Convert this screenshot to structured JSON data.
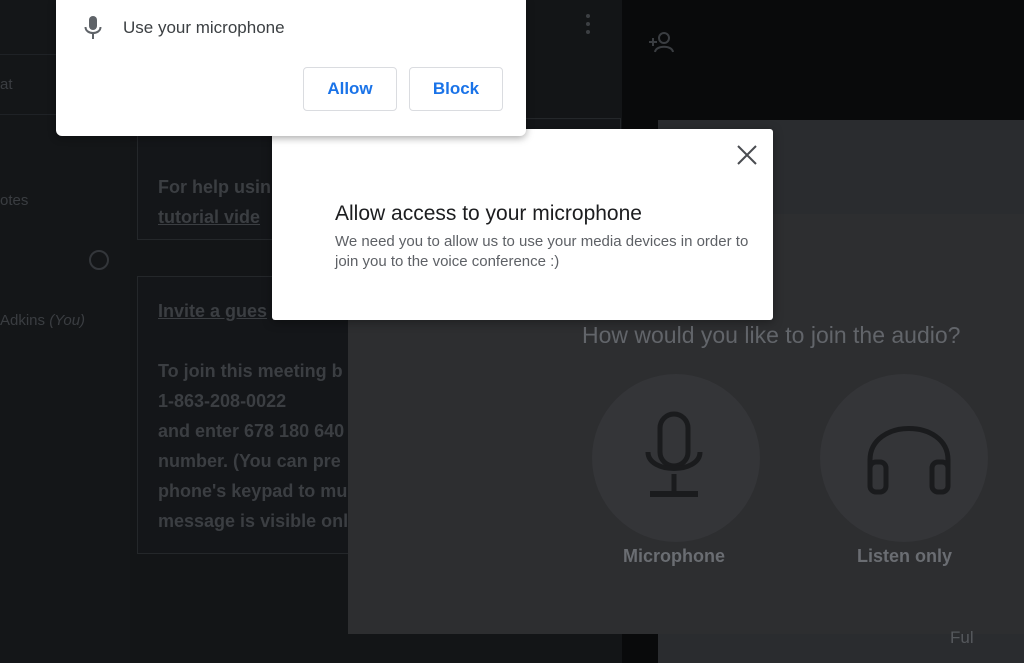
{
  "background": {
    "left_panel": {
      "chat_label": "at",
      "notes_label": "otes",
      "user_name": "Adkins",
      "user_suffix": "(You)"
    },
    "chat": {
      "welcome_line1": "For help usin",
      "welcome_line2": "tutorial vide",
      "invite_heading": "Invite a gues",
      "invite_lines": [
        "To join this meeting b",
        "1-863-208-0022",
        "and enter 678 180 640",
        "number. (You can pre",
        "phone's keypad to mu",
        "message is visible onl"
      ]
    }
  },
  "audio_modal": {
    "title": "How would you like to join the audio?",
    "options": [
      {
        "label": "Microphone",
        "icon": "microphone-icon"
      },
      {
        "label": "Listen only",
        "icon": "headphones-icon"
      }
    ],
    "footer_hint": "Ful"
  },
  "permission_modal": {
    "title": "Allow access to your microphone",
    "description": "We need you to allow us to use your media devices in order to join you to the voice conference :)"
  },
  "browser_prompt": {
    "text": "Use your microphone",
    "allow_label": "Allow",
    "block_label": "Block"
  },
  "colors": {
    "accent": "#1a73e8",
    "overlay_bg": "#0d0f11"
  }
}
